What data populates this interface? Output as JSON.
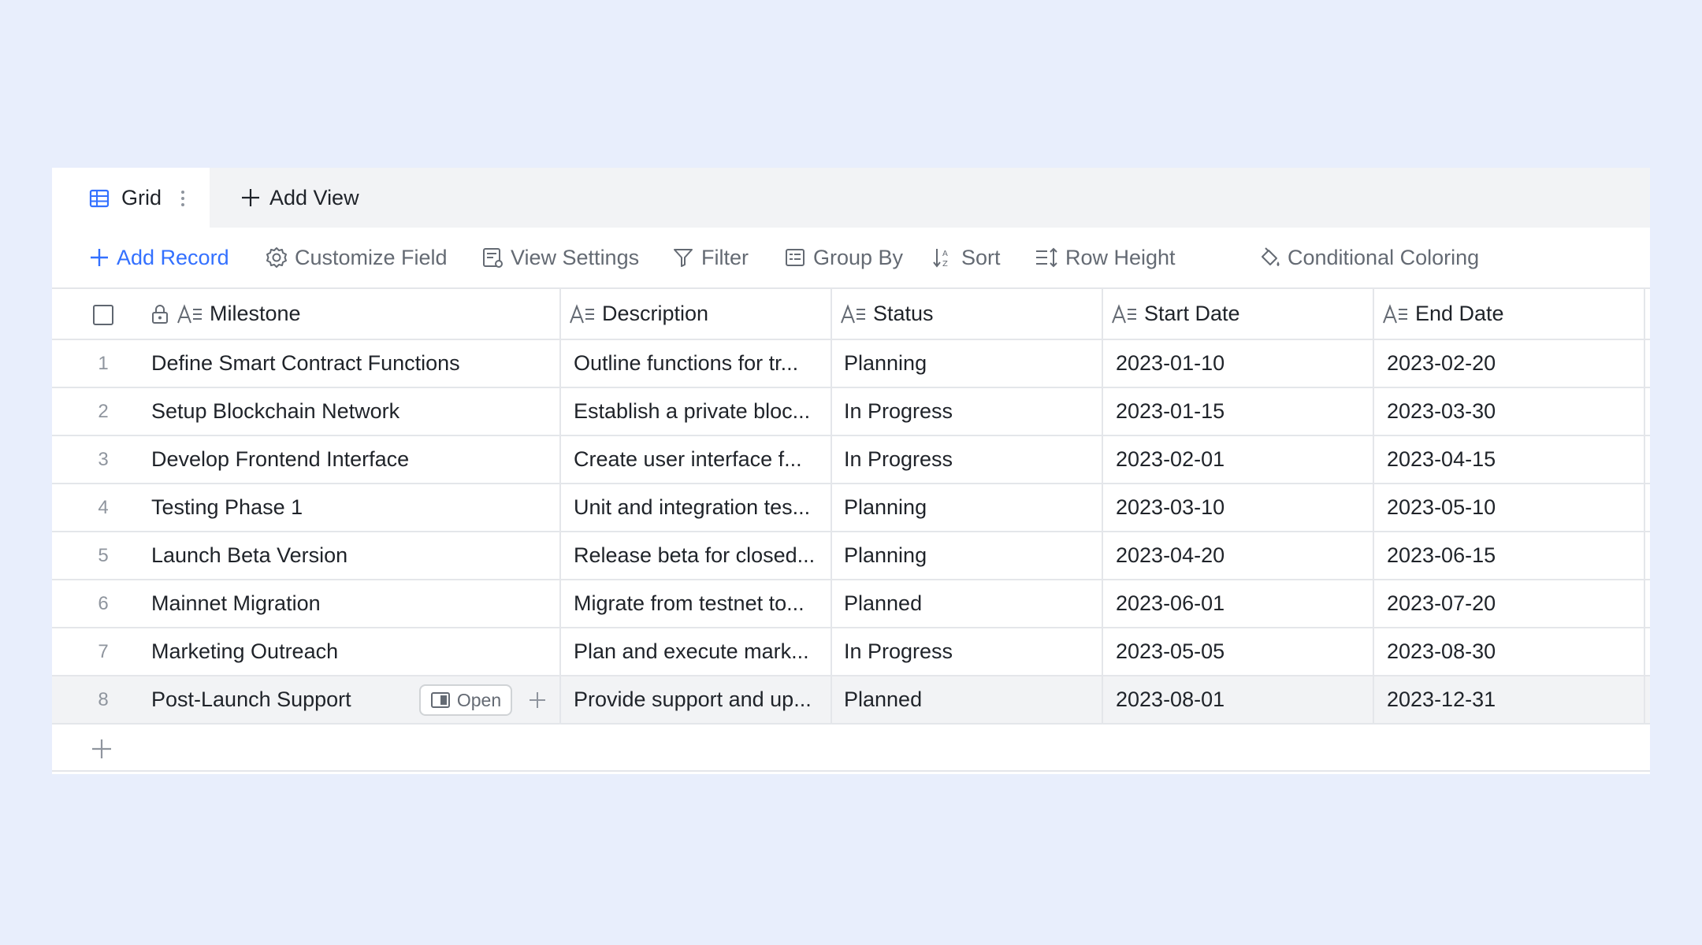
{
  "tabs": {
    "active_label": "Grid",
    "add_view_label": "Add View"
  },
  "toolbar": {
    "add_record": "Add Record",
    "customize_field": "Customize Field",
    "view_settings": "View Settings",
    "filter": "Filter",
    "group_by": "Group By",
    "sort": "Sort",
    "row_height": "Row Height",
    "conditional_coloring": "Conditional Coloring"
  },
  "columns": {
    "milestone": "Milestone",
    "description": "Description",
    "status": "Status",
    "start_date": "Start Date",
    "end_date": "End Date"
  },
  "rows": [
    {
      "num": "1",
      "milestone": "Define Smart Contract Functions",
      "description": "Outline functions for tr...",
      "status": "Planning",
      "start": "2023-01-10",
      "end": "2023-02-20"
    },
    {
      "num": "2",
      "milestone": "Setup Blockchain Network",
      "description": "Establish a private bloc...",
      "status": "In Progress",
      "start": "2023-01-15",
      "end": "2023-03-30"
    },
    {
      "num": "3",
      "milestone": "Develop Frontend Interface",
      "description": "Create user interface f...",
      "status": "In Progress",
      "start": "2023-02-01",
      "end": "2023-04-15"
    },
    {
      "num": "4",
      "milestone": "Testing Phase 1",
      "description": "Unit and integration tes...",
      "status": "Planning",
      "start": "2023-03-10",
      "end": "2023-05-10"
    },
    {
      "num": "5",
      "milestone": "Launch Beta Version",
      "description": "Release beta for closed...",
      "status": "Planning",
      "start": "2023-04-20",
      "end": "2023-06-15"
    },
    {
      "num": "6",
      "milestone": "Mainnet Migration",
      "description": "Migrate from testnet to...",
      "status": "Planned",
      "start": "2023-06-01",
      "end": "2023-07-20"
    },
    {
      "num": "7",
      "milestone": "Marketing Outreach",
      "description": "Plan and execute mark...",
      "status": "In Progress",
      "start": "2023-05-05",
      "end": "2023-08-30"
    },
    {
      "num": "8",
      "milestone": "Post-Launch Support",
      "description": "Provide support and up...",
      "status": "Planned",
      "start": "2023-08-01",
      "end": "2023-12-31"
    }
  ],
  "row_actions": {
    "open_label": "Open"
  },
  "colors": {
    "accent": "#3370ff",
    "background": "#e8eefc",
    "muted_text": "#646a73",
    "hover_row": "#f2f3f5"
  }
}
